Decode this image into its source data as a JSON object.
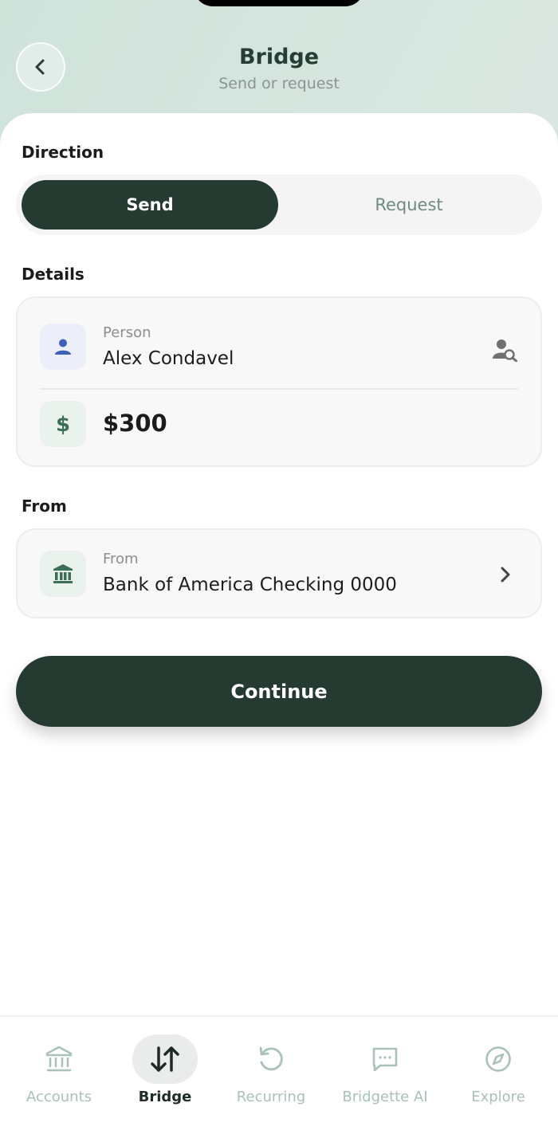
{
  "header": {
    "title": "Bridge",
    "subtitle": "Send or request"
  },
  "direction": {
    "label": "Direction",
    "send": "Send",
    "request": "Request",
    "selected": "Send"
  },
  "details": {
    "label": "Details",
    "person_label": "Person",
    "person_value": "Alex Condavel",
    "amount": "$300"
  },
  "from": {
    "section_label": "From",
    "field_label": "From",
    "account": "Bank of America Checking 0000"
  },
  "continue_label": "Continue",
  "tabbar": {
    "items": [
      {
        "label": "Accounts",
        "icon": "bank-icon"
      },
      {
        "label": "Bridge",
        "icon": "swap-arrows-icon",
        "active": true
      },
      {
        "label": "Recurring",
        "icon": "recurring-icon"
      },
      {
        "label": "Bridgette AI",
        "icon": "chat-icon"
      },
      {
        "label": "Explore",
        "icon": "compass-icon"
      }
    ]
  },
  "colors": {
    "primary": "#253a31",
    "accent_muted": "#a9c1b7",
    "person_icon": "#3f5fb8",
    "money_icon": "#3d6e58"
  }
}
